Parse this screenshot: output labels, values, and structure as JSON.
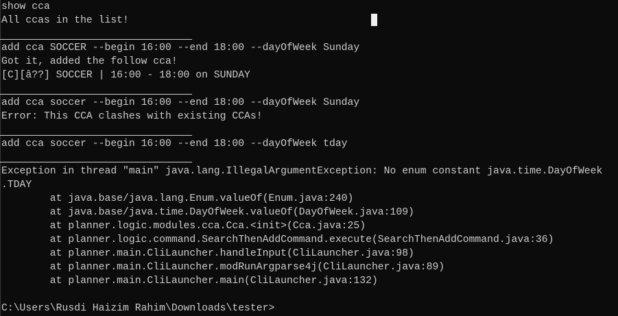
{
  "terminal": {
    "lines": [
      "show cca",
      "All ccas in the list!",
      "add cca SOCCER --begin 16:00 --end 18:00 --dayOfWeek Sunday",
      "Got it, added the follow cca!",
      "[C][â??] SOCCER | 16:00 - 18:00 on SUNDAY",
      "add cca soccer --begin 16:00 --end 18:00 --dayOfWeek Sunday",
      "Error: This CCA clashes with existing CCAs!",
      "add cca soccer --begin 16:00 --end 18:00 --dayOfWeek tday",
      "Exception in thread \"main\" java.lang.IllegalArgumentException: No enum constant java.time.DayOfWeek",
      ".TDAY",
      "        at java.base/java.lang.Enum.valueOf(Enum.java:240)",
      "        at java.base/java.time.DayOfWeek.valueOf(DayOfWeek.java:109)",
      "        at planner.logic.modules.cca.Cca.<init>(Cca.java:25)",
      "        at planner.logic.command.SearchThenAddCommand.execute(SearchThenAddCommand.java:36)",
      "        at planner.main.CliLauncher.handleInput(CliLauncher.java:98)",
      "        at planner.main.CliLauncher.modRunArgparse4j(CliLauncher.java:89)",
      "        at planner.main.CliLauncher.main(CliLauncher.java:132)"
    ],
    "prompt": "C:\\Users\\Rusdi Haizim Rahim\\Downloads\\tester>"
  }
}
